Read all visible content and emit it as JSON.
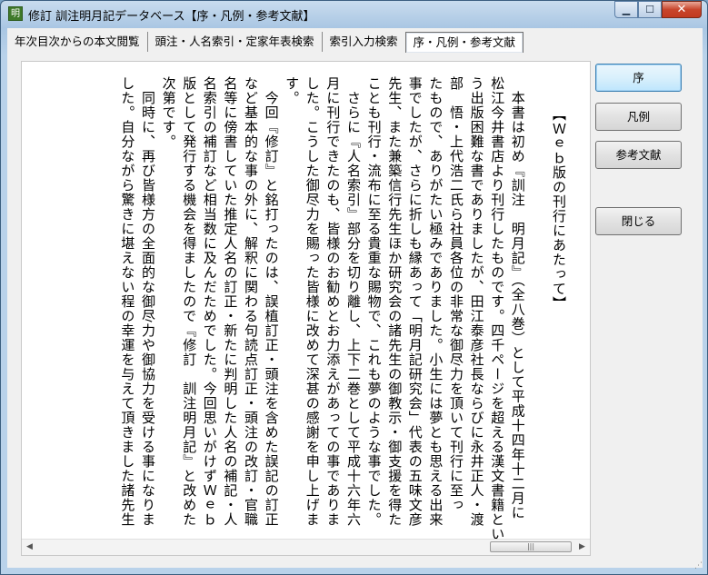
{
  "window": {
    "title": "修訂 訓注明月記データベース【序・凡例・参考文献】",
    "app_icon": "明"
  },
  "tabs": [
    {
      "label": "年次目次からの本文閲覧"
    },
    {
      "label": "頭注・人名索引・定家年表検索"
    },
    {
      "label": "索引入力検索"
    },
    {
      "label": "序・凡例・参考文献"
    }
  ],
  "buttons": {
    "jo": "序",
    "hanrei": "凡例",
    "sanko": "参考文献",
    "close": "閉じる"
  },
  "document": {
    "lines": [
      "【Ｗｅｂ版の刊行にあたって】",
      "",
      "　本書は初め『訓注　明月記』（全八巻）として平成十四年十二月に",
      "松江今井書店より刊行したものです。四千ページを超える漢文書籍とい",
      "う出版困難な書でありましたが、田江泰彦社長ならびに永井正人・渡",
      "部　悟・上代浩二氏ら社員各位の非常な御尽力を頂いて刊行に至っ",
      "たもので、ありがたい極みでありました。小生には夢とも思える出来",
      "事でしたが、さらに折しも縁あって「明月記研究会」代表の五味文彦",
      "先生、また兼築信行先生ほか研究会の諸先生の御教示・御支援を得た",
      "ことも刊行・流布に至る貴重な賜物で、これも夢のような事でした。",
      "　さらに『人名索引』部分を切り離し、上下二巻として平成十六年六",
      "月に刊行できたのも、皆様のお勧めとお力添えがあっての事でありま",
      "した。こうした御尽力を賜った皆様に改めて深甚の感謝を申し上げま",
      "す。",
      "　今回『修訂』と銘打ったのは、誤植訂正・頭注を含めた誤記の訂正",
      "など基本的な事の外に、解釈に関わる句読点訂正・頭注の改訂・官職",
      "名等に傍書していた推定人名の訂正・新たに判明した人名の補記・人",
      "名索引の補訂など相当数に及んだためでした。今回思いがけずＷｅｂ",
      "版として発行する機会を得ましたので『修訂　訓注明月記』と改めた",
      "次第です。",
      "　同時に、再び皆様方の全面的な御尽力や御協力を受ける事になりま",
      "した。自分ながら驚きに堪えない程の幸運を与えて頂きました諸先生"
    ]
  },
  "scrollbar": {
    "grip": "|||"
  }
}
